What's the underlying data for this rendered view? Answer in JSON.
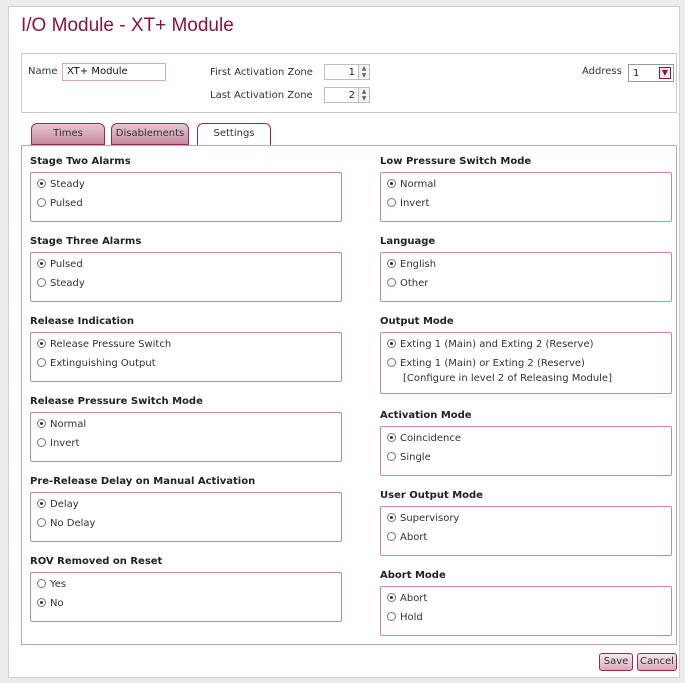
{
  "window": {
    "title": "I/O Module - XT+ Module"
  },
  "header": {
    "name_label": "Name",
    "name_value": "XT+ Module",
    "first_zone_label": "First Activation Zone",
    "first_zone_value": "1",
    "last_zone_label": "Last Activation Zone",
    "last_zone_value": "2",
    "address_label": "Address",
    "address_value": "1"
  },
  "tabs": [
    {
      "label": "Times",
      "active": false
    },
    {
      "label": "Disablements",
      "active": false
    },
    {
      "label": "Settings",
      "active": true
    }
  ],
  "left_groups": [
    {
      "title": "Stage Two Alarms",
      "options": [
        {
          "label": "Steady",
          "selected": true
        },
        {
          "label": "Pulsed",
          "selected": false
        }
      ]
    },
    {
      "title": "Stage Three Alarms",
      "options": [
        {
          "label": "Pulsed",
          "selected": true
        },
        {
          "label": "Steady",
          "selected": false
        }
      ]
    },
    {
      "title": "Release Indication",
      "options": [
        {
          "label": "Release Pressure Switch",
          "selected": true
        },
        {
          "label": "Extinguishing Output",
          "selected": false
        }
      ]
    },
    {
      "title": "Release Pressure Switch Mode",
      "options": [
        {
          "label": "Normal",
          "selected": true
        },
        {
          "label": "Invert",
          "selected": false
        }
      ]
    },
    {
      "title": "Pre-Release Delay on Manual Activation",
      "options": [
        {
          "label": "Delay",
          "selected": true
        },
        {
          "label": "No Delay",
          "selected": false
        }
      ]
    },
    {
      "title": "ROV Removed on Reset",
      "options": [
        {
          "label": "Yes",
          "selected": false
        },
        {
          "label": "No",
          "selected": true
        }
      ]
    }
  ],
  "right_groups": [
    {
      "title": "Low Pressure Switch Mode",
      "options": [
        {
          "label": "Normal",
          "selected": true
        },
        {
          "label": "Invert",
          "selected": false
        }
      ]
    },
    {
      "title": "Language",
      "options": [
        {
          "label": "English",
          "selected": true
        },
        {
          "label": "Other",
          "selected": false
        }
      ]
    },
    {
      "title": "Output Mode",
      "options": [
        {
          "label": "Exting 1 (Main) and Exting 2 (Reserve)",
          "selected": true
        },
        {
          "label": "Exting 1 (Main) or Exting 2 (Reserve)",
          "selected": false
        }
      ],
      "note": "[Configure in level 2 of Releasing Module]"
    },
    {
      "title": "Activation Mode",
      "options": [
        {
          "label": "Coincidence",
          "selected": true
        },
        {
          "label": "Single",
          "selected": false
        }
      ]
    },
    {
      "title": "User Output Mode",
      "options": [
        {
          "label": "Supervisory",
          "selected": true
        },
        {
          "label": "Abort",
          "selected": false
        }
      ]
    },
    {
      "title": "Abort Mode",
      "options": [
        {
          "label": "Abort",
          "selected": true
        },
        {
          "label": "Hold",
          "selected": false
        }
      ]
    }
  ],
  "footer": {
    "save_label": "Save",
    "cancel_label": "Cancel"
  },
  "colors": {
    "accent": "#8a1538",
    "border": "#c98aa1"
  }
}
